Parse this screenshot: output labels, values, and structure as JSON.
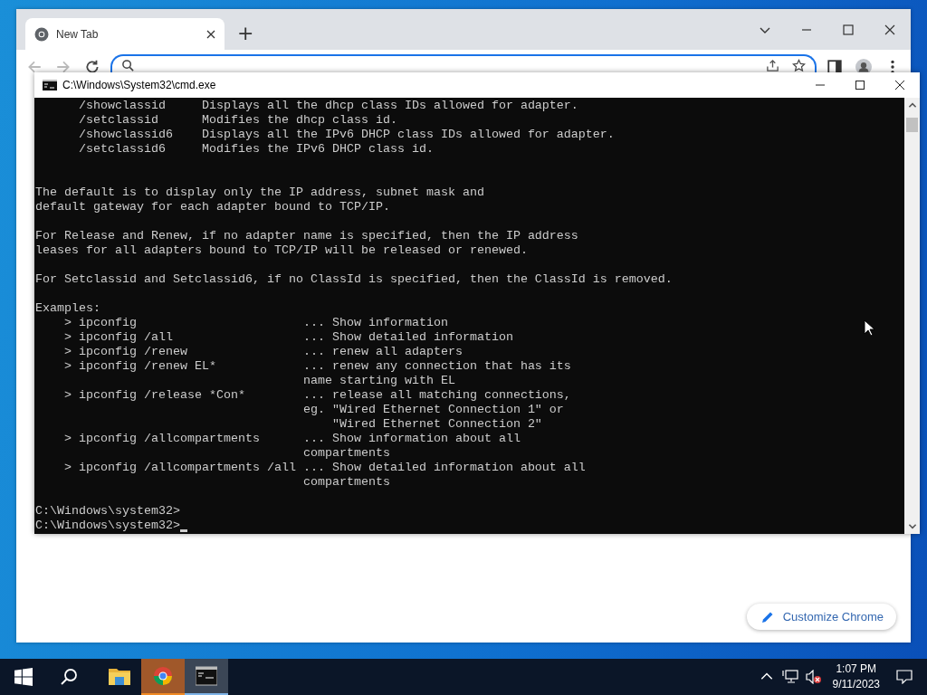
{
  "browser": {
    "tabs": [
      {
        "title": "New Tab",
        "selected": true
      }
    ],
    "new_tab": "+",
    "customize_button": "Customize Chrome"
  },
  "console_window": {
    "title": "C:\\Windows\\System32\\cmd.exe",
    "paragraphs": [
      [
        "      /showclassid     Displays all the dhcp class IDs allowed for adapter.",
        "      /setclassid      Modifies the dhcp class id.",
        "      /showclassid6    Displays all the IPv6 DHCP class IDs allowed for adapter.",
        "      /setclassid6     Modifies the IPv6 DHCP class id."
      ],
      [
        "The default is to display only the IP address, subnet mask and",
        "default gateway for each adapter bound to TCP/IP."
      ],
      [
        "For Release and Renew, if no adapter name is specified, then the IP address",
        "leases for all adapters bound to TCP/IP will be released or renewed."
      ],
      [
        "For Setclassid and Setclassid6, if no ClassId is specified, then the ClassId is removed."
      ],
      [
        "Examples:",
        "    > ipconfig                       ... Show information",
        "    > ipconfig /all                  ... Show detailed information",
        "    > ipconfig /renew                ... renew all adapters",
        "    > ipconfig /renew EL*            ... renew any connection that has its",
        "                                     name starting with EL",
        "    > ipconfig /release *Con*        ... release all matching connections,",
        "                                     eg. \"Wired Ethernet Connection 1\" or",
        "                                         \"Wired Ethernet Connection 2\"",
        "    > ipconfig /allcompartments      ... Show information about all",
        "                                     compartments",
        "    > ipconfig /allcompartments /all ... Show detailed information about all",
        "                                     compartments"
      ],
      [
        "C:\\Windows\\system32>",
        "C:\\Windows\\system32>"
      ]
    ]
  },
  "taskbar": {
    "apps": [
      {
        "kind": "folder",
        "selected": false,
        "flashing": false
      },
      {
        "kind": "chrome",
        "selected": false,
        "flashing": true
      },
      {
        "kind": "console",
        "selected": true,
        "flashing": false
      }
    ],
    "time": "1:07 PM",
    "date": "9/11/2023"
  }
}
